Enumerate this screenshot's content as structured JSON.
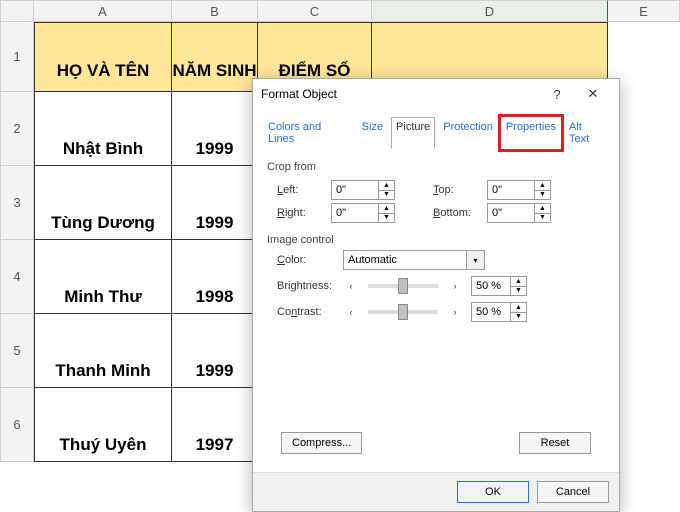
{
  "sheet": {
    "col_labels": [
      "A",
      "B",
      "C",
      "D",
      "E"
    ],
    "row_labels": [
      "1",
      "2",
      "3",
      "4",
      "5",
      "6"
    ],
    "headers": {
      "a": "HỌ VÀ TÊN",
      "b": "NĂM SINH",
      "c": "ĐIỂM SỐ"
    },
    "rows": [
      {
        "a": "Nhật Bình",
        "b": "1999"
      },
      {
        "a": "Tùng Dương",
        "b": "1999"
      },
      {
        "a": "Minh Thư",
        "b": "1998"
      },
      {
        "a": "Thanh Minh",
        "b": "1999"
      },
      {
        "a": "Thuý Uyên",
        "b": "1997"
      }
    ]
  },
  "dialog": {
    "title": "Format Object",
    "tabs": {
      "colors": "Colors and Lines",
      "size": "Size",
      "picture": "Picture",
      "protection": "Protection",
      "properties": "Properties",
      "alttext": "Alt Text"
    },
    "crop_label": "Crop from",
    "left_label": "Left:",
    "right_label": "Right:",
    "top_label": "Top:",
    "bottom_label": "Bottom:",
    "left_val": "0\"",
    "right_val": "0\"",
    "top_val": "0\"",
    "bottom_val": "0\"",
    "image_control": "Image control",
    "color_label": "Color:",
    "color_val": "Automatic",
    "brightness_label": "Brightness:",
    "contrast_label": "Contrast:",
    "brightness_val": "50 %",
    "contrast_val": "50 %",
    "compress": "Compress...",
    "reset": "Reset",
    "ok": "OK",
    "cancel": "Cancel",
    "help": "?",
    "close": "✕"
  }
}
